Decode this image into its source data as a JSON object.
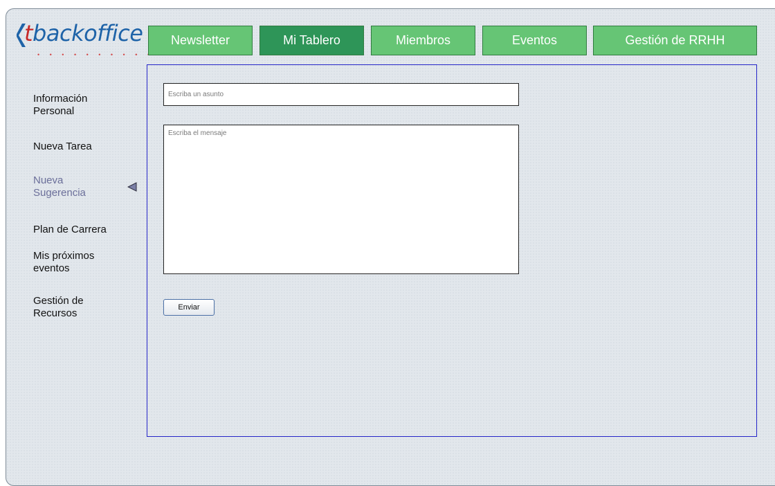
{
  "logo": {
    "brand_first_letter": "t",
    "brand_rest": "backoffice",
    "dots": "• • • • • • • • • • •"
  },
  "nav": {
    "tabs": [
      {
        "label": "Newsletter",
        "active": false
      },
      {
        "label": "Mi Tablero",
        "active": true
      },
      {
        "label": "Miembros",
        "active": false
      },
      {
        "label": "Eventos",
        "active": false
      },
      {
        "label": "Gestión de RRHH",
        "active": false
      }
    ]
  },
  "sidebar": {
    "items": [
      {
        "label": "Información Personal"
      },
      {
        "label": "Nueva Tarea"
      },
      {
        "label": "Nueva Sugerencia",
        "current": true
      },
      {
        "label": "Plan de Carrera"
      },
      {
        "label": "Mis próximos eventos"
      },
      {
        "label": "Gestión de Recursos"
      }
    ],
    "active_marker_icon": "triangle-left-icon"
  },
  "form": {
    "subject": {
      "value": "",
      "placeholder": "Escriba un asunto"
    },
    "message": {
      "value": "",
      "placeholder": "Escriba el mensaje"
    },
    "send_label": "Enviar"
  },
  "colors": {
    "tab_green": "#66c575",
    "tab_active": "#2e9558",
    "panel_border": "#2424c8",
    "brand_blue": "#1e63a8",
    "brand_red": "#c62828",
    "sidebar_current": "#6b6f9a"
  }
}
